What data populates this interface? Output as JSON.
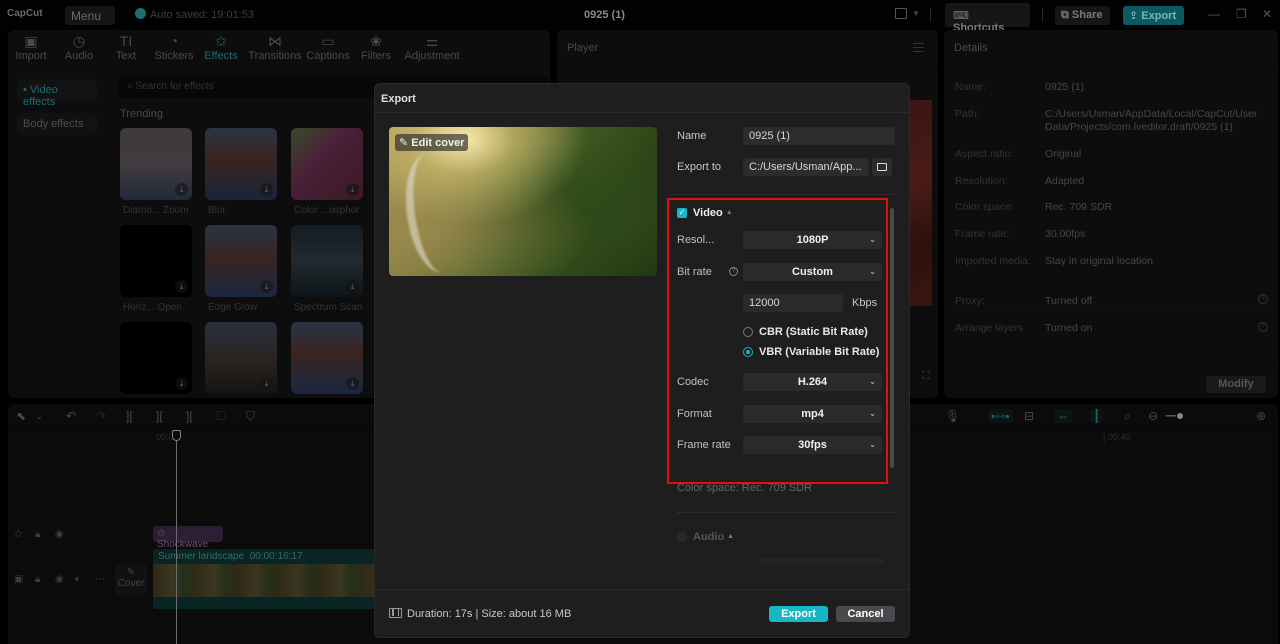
{
  "app": {
    "logo": "CapCut",
    "menu_label": "Menu",
    "autosave": "Auto saved: 19:01:53",
    "title": "0925 (1)",
    "shortcuts_label": "Shortcuts",
    "share_label": "Share",
    "export_label": "Export",
    "accent_color": "#17b6c4"
  },
  "toolbar": {
    "tabs": [
      {
        "label": "Import",
        "icon": "import-icon"
      },
      {
        "label": "Audio",
        "icon": "audio-icon"
      },
      {
        "label": "Text",
        "icon": "text-icon"
      },
      {
        "label": "Stickers",
        "icon": "stickers-icon"
      },
      {
        "label": "Effects",
        "icon": "effects-icon",
        "active": true
      },
      {
        "label": "Transitions",
        "icon": "transitions-icon"
      },
      {
        "label": "Captions",
        "icon": "captions-icon"
      },
      {
        "label": "Filters",
        "icon": "filters-icon"
      },
      {
        "label": "Adjustment",
        "icon": "adjustment-icon"
      }
    ]
  },
  "effects_panel": {
    "sidebar": [
      {
        "label": "• Video effects",
        "active": true
      },
      {
        "label": "Body effects"
      }
    ],
    "search_placeholder": "Search for effects",
    "section_title": "Trending",
    "items": [
      {
        "label": "Diamo... Zoom"
      },
      {
        "label": "Blur"
      },
      {
        "label": "Color ...osphor"
      },
      {
        "label": "Horiz... Open"
      },
      {
        "label": "Edge Glow"
      },
      {
        "label": "Spectrum Scan"
      },
      {
        "label": ""
      },
      {
        "label": ""
      },
      {
        "label": ""
      }
    ]
  },
  "player": {
    "title": "Player"
  },
  "details": {
    "title": "Details",
    "rows": [
      {
        "key": "Name:",
        "value": "0925 (1)"
      },
      {
        "key": "Path:",
        "value": "C:/Users/Usman/AppData/Local/CapCut/User Data/Projects/com.lveditor.draft/0925 (1)"
      },
      {
        "key": "Aspect ratio:",
        "value": "Original"
      },
      {
        "key": "Resolution:",
        "value": "Adapted"
      },
      {
        "key": "Color space:",
        "value": "Rec. 709 SDR"
      },
      {
        "key": "Frame rate:",
        "value": "30.00fps"
      },
      {
        "key": "Imported media:",
        "value": "Stay in original location"
      },
      {
        "key": "Proxy:",
        "value": "Turned off"
      },
      {
        "key": "Arrange layers",
        "value": "Turned on"
      }
    ],
    "modify_label": "Modify"
  },
  "timeline": {
    "ruler_start": "00:00",
    "ruler_mark": "| 00:40",
    "effect_clip": "Shockwave",
    "video_clip_name": "Summer landscape",
    "video_clip_duration": "00:00:16:17",
    "cover_label": "Cover"
  },
  "export_dialog": {
    "title": "Export",
    "edit_cover_label": "Edit cover",
    "name_label": "Name",
    "name_value": "0925 (1)",
    "export_to_label": "Export to",
    "export_to_value": "C:/Users/Usman/App...",
    "video": {
      "section_label": "Video",
      "enabled": true,
      "resolution_label": "Resol...",
      "resolution_value": "1080P",
      "bitrate_label": "Bit rate",
      "bitrate_value": "Custom",
      "bitrate_kbps": "12000",
      "bitrate_unit": "Kbps",
      "cbr_label": "CBR (Static Bit Rate)",
      "vbr_label": "VBR (Variable Bit Rate)",
      "rate_mode": "VBR",
      "codec_label": "Codec",
      "codec_value": "H.264",
      "format_label": "Format",
      "format_value": "mp4",
      "framerate_label": "Frame rate",
      "framerate_value": "30fps",
      "color_space": "Color space: Rec. 709 SDR"
    },
    "audio": {
      "section_label": "Audio",
      "enabled": false
    },
    "summary": "Duration: 17s | Size: about 16 MB",
    "export_button": "Export",
    "cancel_button": "Cancel"
  }
}
